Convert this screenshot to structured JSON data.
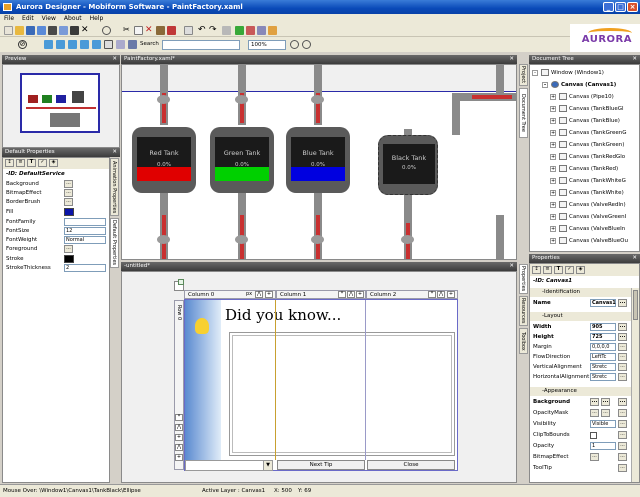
{
  "window": {
    "title": "Aurora Designer - Mobiform Software - PaintFactory.xaml"
  },
  "menu": [
    "File",
    "Edit",
    "View",
    "About",
    "Help"
  ],
  "toolbar": {
    "search_label": "Search",
    "zoom": "100%"
  },
  "logo": {
    "text": "AURORA"
  },
  "preview": {
    "title": "Preview"
  },
  "default_properties": {
    "title": "Default Properties",
    "id": "-ID: DefaultService",
    "rows": [
      {
        "name": "Background",
        "value": ""
      },
      {
        "name": "BitmapEffect",
        "value": ""
      },
      {
        "name": "BorderBrush",
        "value": ""
      },
      {
        "name": "Fill",
        "value": ""
      },
      {
        "name": "FontFamily",
        "value": ""
      },
      {
        "name": "FontSize",
        "value": "12"
      },
      {
        "name": "FontWeight",
        "value": "Normal"
      },
      {
        "name": "Foreground",
        "value": ""
      },
      {
        "name": "Stroke",
        "value": ""
      },
      {
        "name": "StrokeThickness",
        "value": "2"
      }
    ],
    "side_tabs": [
      "Animation Properties",
      "Default Properties"
    ]
  },
  "canvas_tab": {
    "title": "PaintFactory.xaml*"
  },
  "tanks": [
    {
      "label": "Red Tank",
      "pct": "0.0%",
      "color": "#e00000"
    },
    {
      "label": "Green Tank",
      "pct": "0.0%",
      "color": "#00d000"
    },
    {
      "label": "Blue Tank",
      "pct": "0.0%",
      "color": "#0000e0"
    },
    {
      "label": "Black Tank",
      "pct": "0.0%",
      "color": "#303030"
    }
  ],
  "untitled_tab": {
    "title": "-untitled*"
  },
  "dialog": {
    "columns": [
      "Column 0",
      "Column 1",
      "Column 2"
    ],
    "row0": "Row 0",
    "heading": "Did you know...",
    "next_tip": "Next Tip",
    "close": "Close",
    "unit": "px"
  },
  "document_tree": {
    "title": "Document Tree",
    "side_tabs": [
      "Project",
      "Document Tree"
    ],
    "root": "Window (Window1)",
    "canvas": "Canvas (Canvas1)",
    "items": [
      "Canvas (Pipe10)",
      "Canvas (TankBlueGl",
      "Canvas (TankBlue)",
      "Canvas (TankGreenG",
      "Canvas (TankGreen)",
      "Canvas (TankRedGlo",
      "Canvas (TankRed)",
      "Canvas (TankWhiteG",
      "Canvas (TankWhite)",
      "Canvas (ValveRedIn)",
      "Canvas (ValveGreenI",
      "Canvas (ValveBlueIn",
      "Canvas (ValveBlueOu"
    ]
  },
  "properties": {
    "title": "Properties",
    "id": "-ID: Canvas1",
    "side_tabs": [
      "Properties",
      "Resources",
      "Toolbox"
    ],
    "identification_label": "-Identification",
    "name_label": "Name",
    "name_value": "Canvas1",
    "layout_label": "-Layout",
    "layout": [
      {
        "name": "Width",
        "value": "905",
        "bold": true
      },
      {
        "name": "Height",
        "value": "725",
        "bold": true
      },
      {
        "name": "Margin",
        "value": "0,0,0,0",
        "bold": false
      },
      {
        "name": "FlowDirection",
        "value": "LeftTc",
        "bold": false
      },
      {
        "name": "VerticalAlignment",
        "value": "Stretc",
        "bold": false
      },
      {
        "name": "HorizontalAlignment",
        "value": "Stretc",
        "bold": false
      }
    ],
    "appearance_label": "-Appearance",
    "appearance": [
      {
        "name": "Background",
        "value": "",
        "bold": true
      },
      {
        "name": "OpacityMask",
        "value": "",
        "bold": false
      },
      {
        "name": "Visibility",
        "value": "Visible",
        "bold": false
      },
      {
        "name": "ClipToBounds",
        "value": "",
        "bold": false
      },
      {
        "name": "Opacity",
        "value": "1",
        "bold": false
      },
      {
        "name": "BitmapEffect",
        "value": "",
        "bold": false
      },
      {
        "name": "ToolTip",
        "value": "",
        "bold": false
      }
    ]
  },
  "status": {
    "mouse_over": "Mouse Over: \\Window1\\Canvas1\\TankBlack\\Ellipse",
    "active_layer": "Active Layer : Canvas1",
    "x": "X: 500",
    "y": "Y: 69"
  }
}
